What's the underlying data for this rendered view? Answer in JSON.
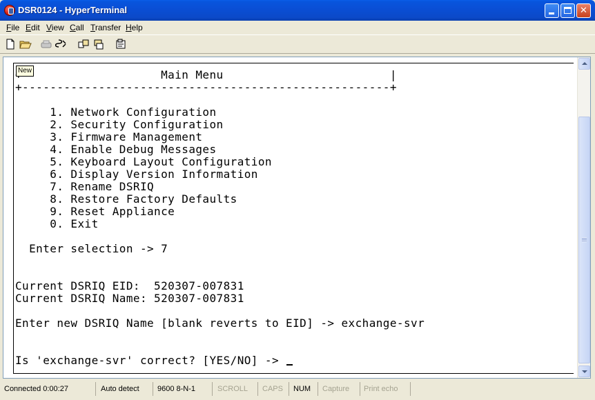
{
  "window": {
    "title": "DSR0124 - HyperTerminal"
  },
  "menu": [
    {
      "underline": "F",
      "rest": "ile"
    },
    {
      "underline": "E",
      "rest": "dit"
    },
    {
      "underline": "V",
      "rest": "iew"
    },
    {
      "underline": "C",
      "rest": "all"
    },
    {
      "underline": "T",
      "rest": "ransfer"
    },
    {
      "underline": "H",
      "rest": "elp"
    }
  ],
  "toolbar": {
    "icons": [
      "new-icon",
      "open-icon",
      "connect-icon",
      "disconnect-icon",
      "send-icon",
      "receive-icon",
      "properties-icon"
    ]
  },
  "tooltip": "New",
  "terminal": {
    "lines": [
      "+                    Main Menu                        |",
      "+-----------------------------------------------------+",
      "",
      "     1. Network Configuration",
      "     2. Security Configuration",
      "     3. Firmware Management",
      "     4. Enable Debug Messages",
      "     5. Keyboard Layout Configuration",
      "     6. Display Version Information",
      "     7. Rename DSRIQ",
      "     8. Restore Factory Defaults",
      "     9. Reset Appliance",
      "     0. Exit",
      "",
      "  Enter selection -> 7",
      "",
      "",
      "Current DSRIQ EID:  520307-007831",
      "Current DSRIQ Name: 520307-007831",
      "",
      "Enter new DSRIQ Name [blank reverts to EID] -> exchange-svr",
      "",
      "",
      "Is 'exchange-svr' correct? [YES/NO] -> "
    ]
  },
  "status": {
    "connected": "Connected 0:00:27",
    "detect": "Auto detect",
    "port": "9600 8-N-1",
    "scroll": "SCROLL",
    "caps": "CAPS",
    "num": "NUM",
    "capture": "Capture",
    "print_echo": "Print echo"
  }
}
